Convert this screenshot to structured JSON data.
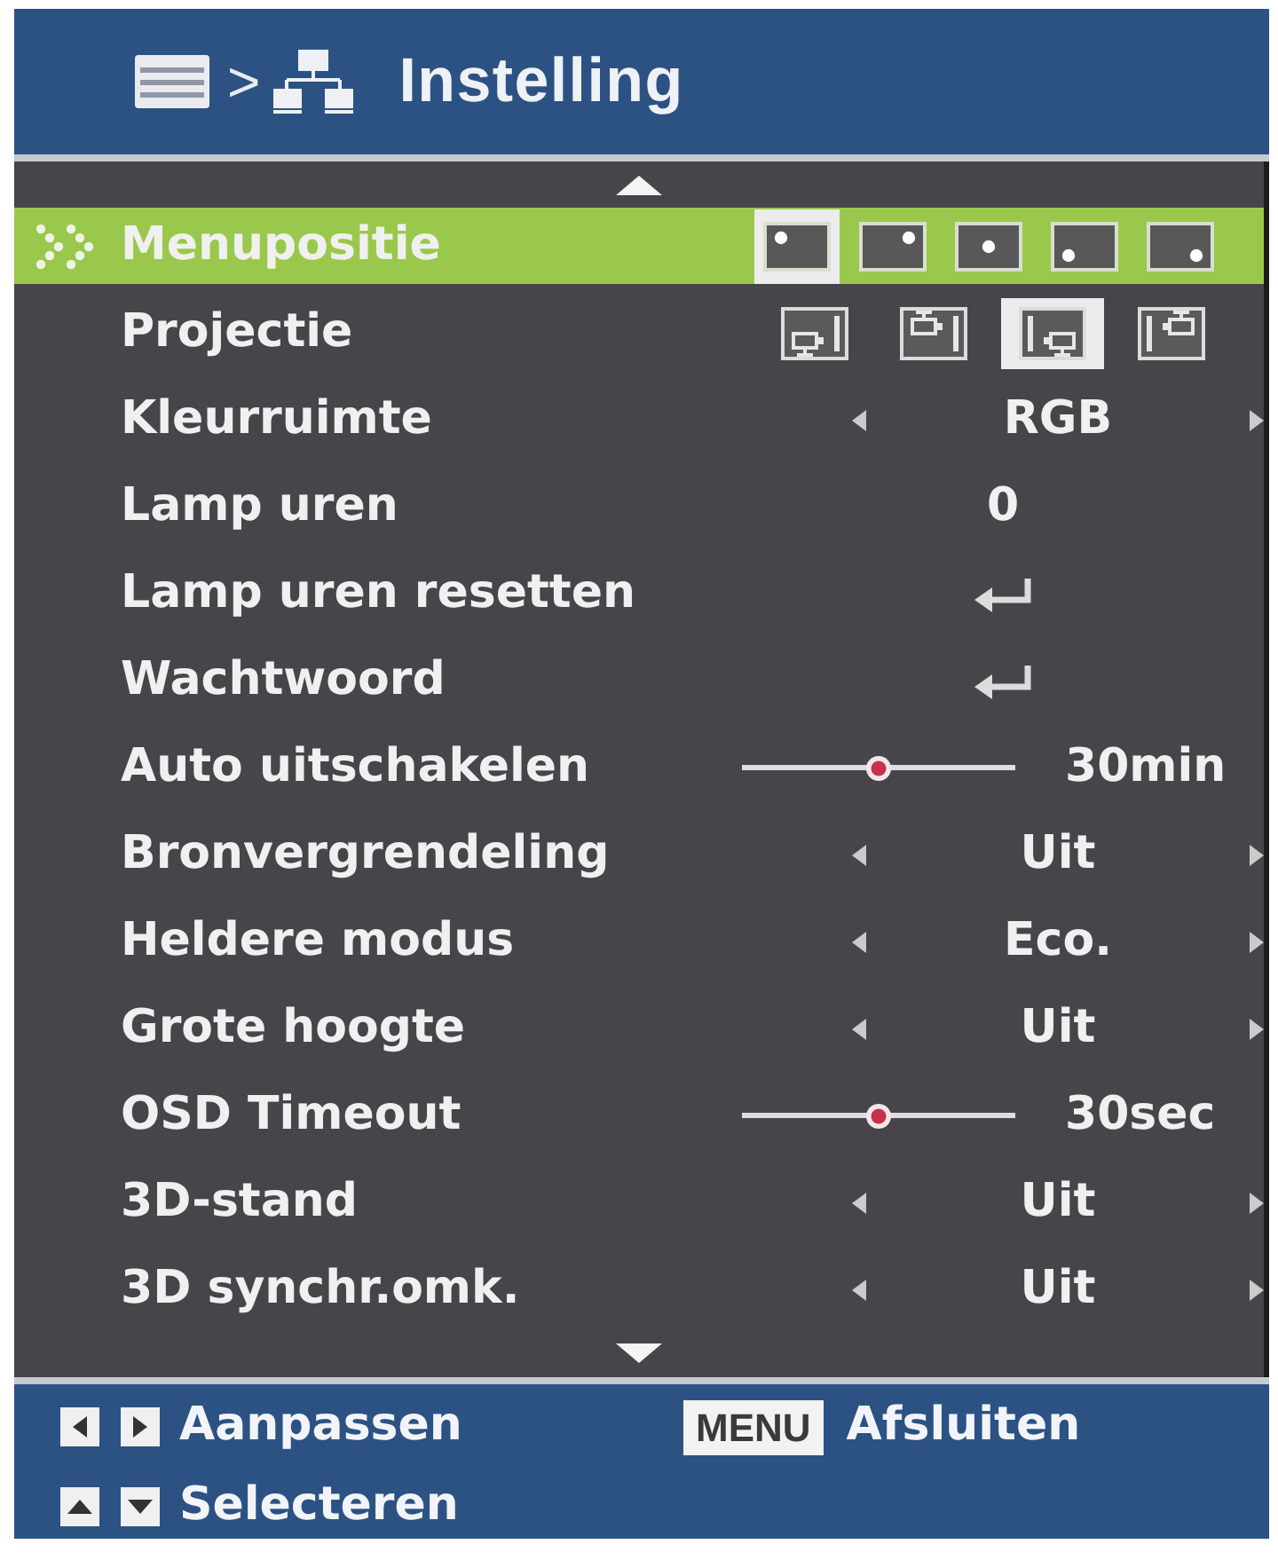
{
  "header": {
    "separator": ">",
    "title": "Instelling"
  },
  "rows": [
    {
      "kind": "position",
      "label": "Menupositie",
      "selected": true,
      "options": [
        {
          "selected": true
        },
        {
          "selected": false
        },
        {
          "selected": false
        },
        {
          "selected": false
        },
        {
          "selected": false
        }
      ]
    },
    {
      "kind": "projection",
      "label": "Projectie",
      "selected": false,
      "options": [
        {
          "selected": false
        },
        {
          "selected": false
        },
        {
          "selected": true
        },
        {
          "selected": false
        }
      ]
    },
    {
      "kind": "choice",
      "label": "Kleurruimte",
      "selected": false,
      "value": "RGB"
    },
    {
      "kind": "readout",
      "label": "Lamp uren",
      "selected": false,
      "value": "0"
    },
    {
      "kind": "enter",
      "label": "Lamp uren resetten",
      "selected": false
    },
    {
      "kind": "enter",
      "label": "Wachtwoord",
      "selected": false
    },
    {
      "kind": "slider",
      "label": "Auto uitschakelen",
      "selected": false,
      "level": 0.5,
      "reading": "30min"
    },
    {
      "kind": "choice",
      "label": "Bronvergrendeling",
      "selected": false,
      "value": "Uit"
    },
    {
      "kind": "choice",
      "label": "Heldere modus",
      "selected": false,
      "value": "Eco."
    },
    {
      "kind": "choice",
      "label": "Grote hoogte",
      "selected": false,
      "value": "Uit"
    },
    {
      "kind": "slider",
      "label": "OSD Timeout",
      "selected": false,
      "level": 0.5,
      "reading": "30sec"
    },
    {
      "kind": "choice",
      "label": "3D-stand",
      "selected": false,
      "value": "Uit"
    },
    {
      "kind": "choice",
      "label": "3D synchr.omk.",
      "selected": false,
      "value": "Uit"
    }
  ],
  "footer": {
    "hints": [
      {
        "kind": "arrows_horizontal",
        "label": "Aanpassen"
      },
      {
        "kind": "key",
        "key": "MENU",
        "label": "Afsluiten"
      },
      {
        "kind": "arrows_vertical",
        "label": "Selecteren"
      }
    ]
  }
}
